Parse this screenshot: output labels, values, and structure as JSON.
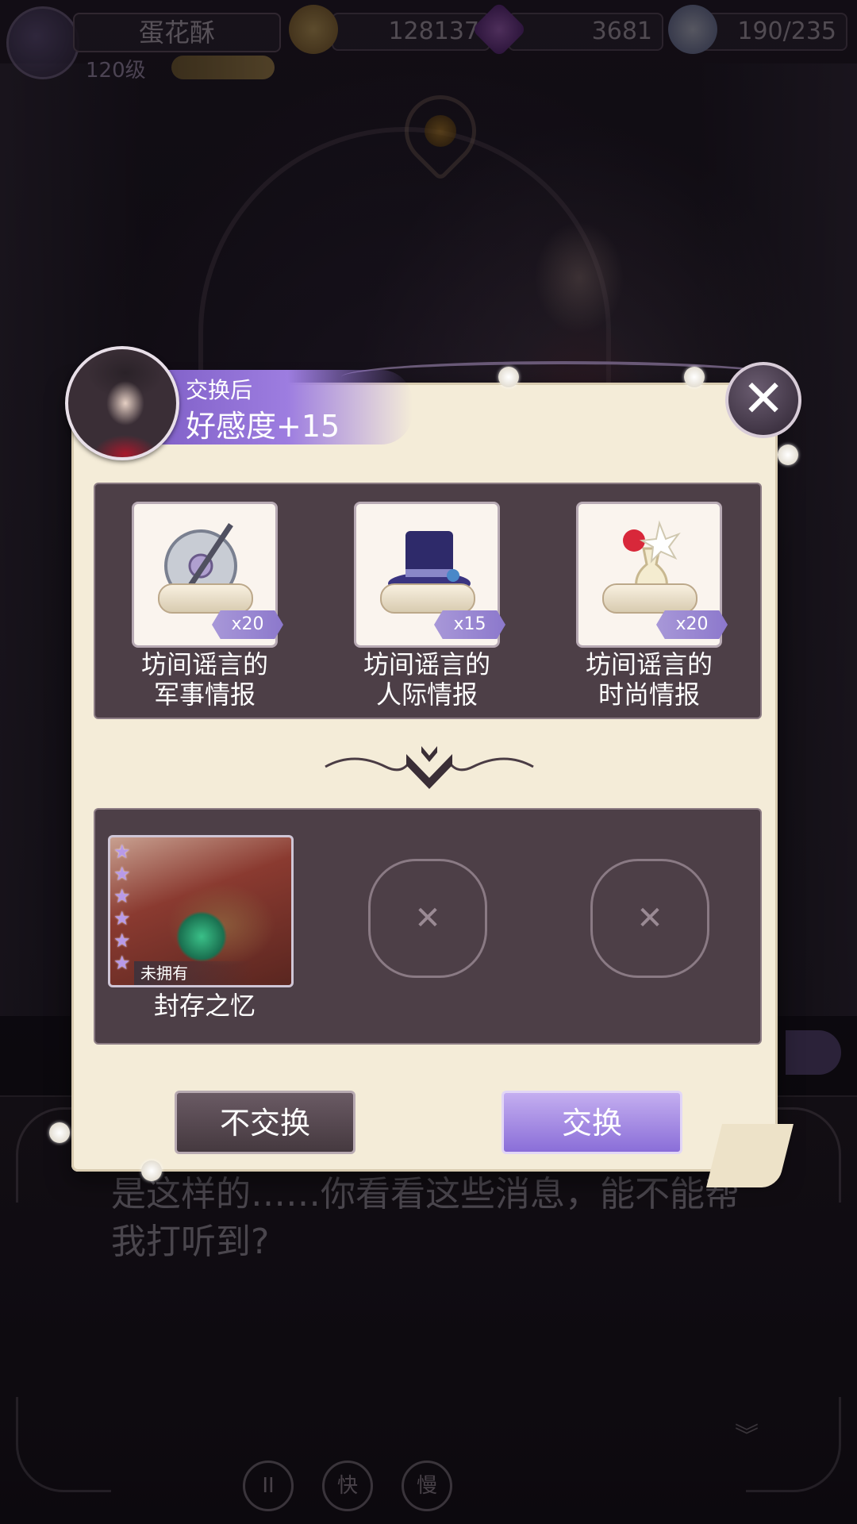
{
  "hud": {
    "player_name": "蛋花酥",
    "level": "120级",
    "badge": "",
    "gold": "128137",
    "gems": "3681",
    "energy": "190/235"
  },
  "exchange": {
    "header_sub": "交换后",
    "header_main": "好感度+15",
    "close_symbol": "✕",
    "offer_items": [
      {
        "line1": "坊间谣言的",
        "line2": "军事情报",
        "qty": "x20",
        "icon": "shield-sword-icon"
      },
      {
        "line1": "坊间谣言的",
        "line2": "人际情报",
        "qty": "x15",
        "icon": "top-hat-icon"
      },
      {
        "line1": "坊间谣言的",
        "line2": "时尚情报",
        "qty": "x20",
        "icon": "flower-vase-icon"
      }
    ],
    "reward": {
      "label": "封存之忆",
      "status": "未拥有",
      "stars": 6
    },
    "decline_label": "不交换",
    "confirm_label": "交换"
  },
  "dialogue": {
    "text": "是这样的……你看看这些消息，能不能帮我打听到?"
  },
  "controls": {
    "pause": "II",
    "fast": "快",
    "slow": "慢"
  },
  "colors": {
    "accent_purple": "#8a6ed8",
    "panel_bg": "#f4ecd8",
    "box_bg": "#4d3f47"
  }
}
